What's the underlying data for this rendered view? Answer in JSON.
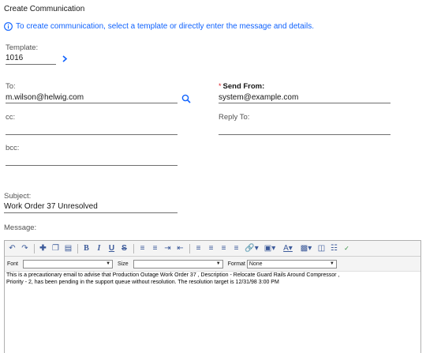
{
  "page": {
    "title": "Create Communication"
  },
  "info": {
    "text": "To create communication, select a template or directly enter the message and details."
  },
  "template": {
    "label": "Template:",
    "value": "1016"
  },
  "to": {
    "label": "To:",
    "value": "m.wilson@helwig.com"
  },
  "send_from": {
    "label": "Send From:",
    "value": "system@example.com",
    "required_mark": "*"
  },
  "cc": {
    "label": "cc:",
    "value": ""
  },
  "reply_to": {
    "label": "Reply To:",
    "value": ""
  },
  "bcc": {
    "label": "bcc:",
    "value": ""
  },
  "subject": {
    "label": "Subject:",
    "value": "Work Order 37 Unresolved"
  },
  "message": {
    "label": "Message:",
    "font_label": "Font",
    "size_label": "Size",
    "format_label": "Format",
    "font_value": "",
    "size_value": "",
    "format_value": "None",
    "body_line1": "This is a precautionary email to advise that Production Outage Work Order 37 , Description - Relocate Guard Rails Around Compressor ,",
    "body_line2": "Priority - 2, has been pending in the support queue without resolution. The resolution target is 12/31/98 3:00 PM"
  },
  "colors": {
    "accent": "#0f62fe",
    "required": "#da1e28",
    "text": "#161616",
    "label": "#525252"
  },
  "toolbar_icons": [
    "undo-icon",
    "redo-icon",
    "insert-icon",
    "copy-icon",
    "paste-icon",
    "bold-icon",
    "italic-icon",
    "underline-icon",
    "strikethrough-icon",
    "ordered-list-icon",
    "unordered-list-icon",
    "indent-icon",
    "outdent-icon",
    "align-left-icon",
    "align-center-icon",
    "align-right-icon",
    "justify-icon",
    "link-icon",
    "image-icon",
    "font-color-icon",
    "highlight-color-icon",
    "source-icon",
    "preview-icon",
    "spellcheck-icon"
  ]
}
